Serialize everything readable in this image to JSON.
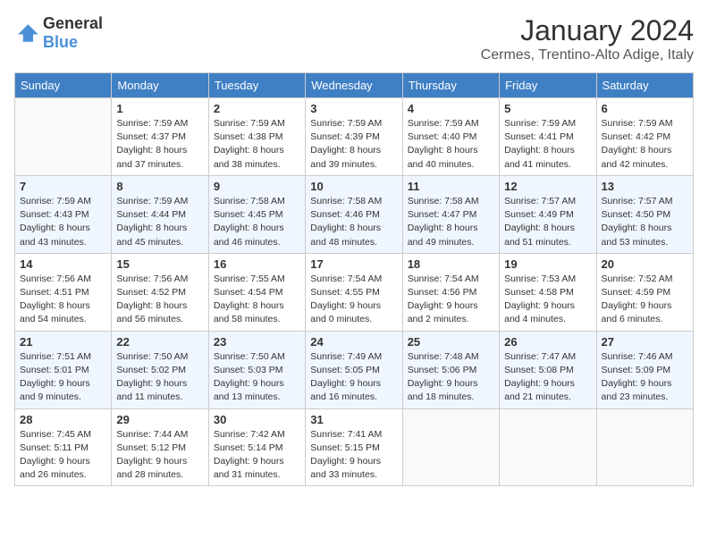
{
  "header": {
    "logo_general": "General",
    "logo_blue": "Blue",
    "month": "January 2024",
    "location": "Cermes, Trentino-Alto Adige, Italy"
  },
  "columns": [
    "Sunday",
    "Monday",
    "Tuesday",
    "Wednesday",
    "Thursday",
    "Friday",
    "Saturday"
  ],
  "weeks": [
    [
      {
        "day": "",
        "info": ""
      },
      {
        "day": "1",
        "info": "Sunrise: 7:59 AM\nSunset: 4:37 PM\nDaylight: 8 hours\nand 37 minutes."
      },
      {
        "day": "2",
        "info": "Sunrise: 7:59 AM\nSunset: 4:38 PM\nDaylight: 8 hours\nand 38 minutes."
      },
      {
        "day": "3",
        "info": "Sunrise: 7:59 AM\nSunset: 4:39 PM\nDaylight: 8 hours\nand 39 minutes."
      },
      {
        "day": "4",
        "info": "Sunrise: 7:59 AM\nSunset: 4:40 PM\nDaylight: 8 hours\nand 40 minutes."
      },
      {
        "day": "5",
        "info": "Sunrise: 7:59 AM\nSunset: 4:41 PM\nDaylight: 8 hours\nand 41 minutes."
      },
      {
        "day": "6",
        "info": "Sunrise: 7:59 AM\nSunset: 4:42 PM\nDaylight: 8 hours\nand 42 minutes."
      }
    ],
    [
      {
        "day": "7",
        "info": "Sunrise: 7:59 AM\nSunset: 4:43 PM\nDaylight: 8 hours\nand 43 minutes."
      },
      {
        "day": "8",
        "info": "Sunrise: 7:59 AM\nSunset: 4:44 PM\nDaylight: 8 hours\nand 45 minutes."
      },
      {
        "day": "9",
        "info": "Sunrise: 7:58 AM\nSunset: 4:45 PM\nDaylight: 8 hours\nand 46 minutes."
      },
      {
        "day": "10",
        "info": "Sunrise: 7:58 AM\nSunset: 4:46 PM\nDaylight: 8 hours\nand 48 minutes."
      },
      {
        "day": "11",
        "info": "Sunrise: 7:58 AM\nSunset: 4:47 PM\nDaylight: 8 hours\nand 49 minutes."
      },
      {
        "day": "12",
        "info": "Sunrise: 7:57 AM\nSunset: 4:49 PM\nDaylight: 8 hours\nand 51 minutes."
      },
      {
        "day": "13",
        "info": "Sunrise: 7:57 AM\nSunset: 4:50 PM\nDaylight: 8 hours\nand 53 minutes."
      }
    ],
    [
      {
        "day": "14",
        "info": "Sunrise: 7:56 AM\nSunset: 4:51 PM\nDaylight: 8 hours\nand 54 minutes."
      },
      {
        "day": "15",
        "info": "Sunrise: 7:56 AM\nSunset: 4:52 PM\nDaylight: 8 hours\nand 56 minutes."
      },
      {
        "day": "16",
        "info": "Sunrise: 7:55 AM\nSunset: 4:54 PM\nDaylight: 8 hours\nand 58 minutes."
      },
      {
        "day": "17",
        "info": "Sunrise: 7:54 AM\nSunset: 4:55 PM\nDaylight: 9 hours\nand 0 minutes."
      },
      {
        "day": "18",
        "info": "Sunrise: 7:54 AM\nSunset: 4:56 PM\nDaylight: 9 hours\nand 2 minutes."
      },
      {
        "day": "19",
        "info": "Sunrise: 7:53 AM\nSunset: 4:58 PM\nDaylight: 9 hours\nand 4 minutes."
      },
      {
        "day": "20",
        "info": "Sunrise: 7:52 AM\nSunset: 4:59 PM\nDaylight: 9 hours\nand 6 minutes."
      }
    ],
    [
      {
        "day": "21",
        "info": "Sunrise: 7:51 AM\nSunset: 5:01 PM\nDaylight: 9 hours\nand 9 minutes."
      },
      {
        "day": "22",
        "info": "Sunrise: 7:50 AM\nSunset: 5:02 PM\nDaylight: 9 hours\nand 11 minutes."
      },
      {
        "day": "23",
        "info": "Sunrise: 7:50 AM\nSunset: 5:03 PM\nDaylight: 9 hours\nand 13 minutes."
      },
      {
        "day": "24",
        "info": "Sunrise: 7:49 AM\nSunset: 5:05 PM\nDaylight: 9 hours\nand 16 minutes."
      },
      {
        "day": "25",
        "info": "Sunrise: 7:48 AM\nSunset: 5:06 PM\nDaylight: 9 hours\nand 18 minutes."
      },
      {
        "day": "26",
        "info": "Sunrise: 7:47 AM\nSunset: 5:08 PM\nDaylight: 9 hours\nand 21 minutes."
      },
      {
        "day": "27",
        "info": "Sunrise: 7:46 AM\nSunset: 5:09 PM\nDaylight: 9 hours\nand 23 minutes."
      }
    ],
    [
      {
        "day": "28",
        "info": "Sunrise: 7:45 AM\nSunset: 5:11 PM\nDaylight: 9 hours\nand 26 minutes."
      },
      {
        "day": "29",
        "info": "Sunrise: 7:44 AM\nSunset: 5:12 PM\nDaylight: 9 hours\nand 28 minutes."
      },
      {
        "day": "30",
        "info": "Sunrise: 7:42 AM\nSunset: 5:14 PM\nDaylight: 9 hours\nand 31 minutes."
      },
      {
        "day": "31",
        "info": "Sunrise: 7:41 AM\nSunset: 5:15 PM\nDaylight: 9 hours\nand 33 minutes."
      },
      {
        "day": "",
        "info": ""
      },
      {
        "day": "",
        "info": ""
      },
      {
        "day": "",
        "info": ""
      }
    ]
  ]
}
